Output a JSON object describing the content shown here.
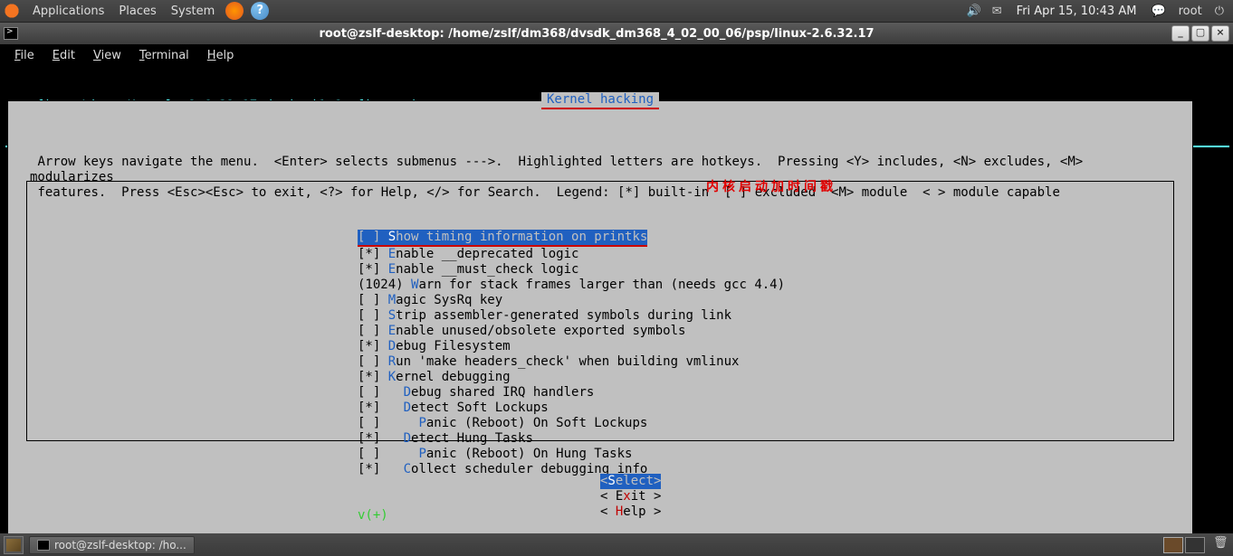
{
  "top_panel": {
    "apps": "Applications",
    "places": "Places",
    "system": "System",
    "clock": "Fri Apr 15, 10:43 AM",
    "user": "root"
  },
  "window": {
    "title": "root@zslf-desktop: /home/zslf/dm368/dvsdk_dm368_4_02_00_06/psp/linux-2.6.32.17"
  },
  "menubar": {
    "file": "File",
    "edit": "Edit",
    "view": "View",
    "terminal": "Terminal",
    "help": "Help"
  },
  "config": {
    "title": ".config - Linux Kernel v2.6.32.17-davinci1 Configuration",
    "section": "Kernel hacking",
    "instructions_l1": " Arrow keys navigate the menu.  <Enter> selects submenus --->.  Highlighted letters are hotkeys.  Pressing <Y> includes, <N> excludes, <M> modularizes",
    "instructions_l2": " features.  Press <Esc><Esc> to exit, <?> for Help, </> for Search.  Legend: [*] built-in  [ ] excluded  <M> module  < > module capable",
    "options": [
      {
        "mark": "[ ]",
        "indent": "",
        "hot": "S",
        "rest": "how timing information on printks",
        "selected": true
      },
      {
        "mark": "[*]",
        "indent": "",
        "hot": "E",
        "rest": "nable __deprecated logic"
      },
      {
        "mark": "[*]",
        "indent": "",
        "hot": "E",
        "rest": "nable __must_check logic"
      },
      {
        "mark": "(1024)",
        "indent": "",
        "hot": "W",
        "rest": "arn for stack frames larger than (needs gcc 4.4)"
      },
      {
        "mark": "[ ]",
        "indent": "",
        "hot": "M",
        "rest": "agic SysRq key"
      },
      {
        "mark": "[ ]",
        "indent": "",
        "hot": "S",
        "rest": "trip assembler-generated symbols during link"
      },
      {
        "mark": "[ ]",
        "indent": "",
        "hot": "E",
        "rest": "nable unused/obsolete exported symbols"
      },
      {
        "mark": "[*]",
        "indent": "",
        "hot": "D",
        "rest": "ebug Filesystem"
      },
      {
        "mark": "[ ]",
        "indent": "",
        "hot": "R",
        "rest": "un 'make headers_check' when building vmlinux"
      },
      {
        "mark": "[*]",
        "indent": "",
        "hot": "K",
        "rest": "ernel debugging"
      },
      {
        "mark": "[ ]",
        "indent": "  ",
        "hot": "D",
        "rest": "ebug shared IRQ handlers"
      },
      {
        "mark": "[*]",
        "indent": "  ",
        "hot": "D",
        "rest": "etect Soft Lockups"
      },
      {
        "mark": "[ ]",
        "indent": "    ",
        "hot": "P",
        "rest": "anic (Reboot) On Soft Lockups"
      },
      {
        "mark": "[*]",
        "indent": "  ",
        "hot": "D",
        "rest": "etect Hung Tasks"
      },
      {
        "mark": "[ ]",
        "indent": "    ",
        "hot": "P",
        "rest": "anic (Reboot) On Hung Tasks"
      },
      {
        "mark": "[*]",
        "indent": "  ",
        "hot": "C",
        "rest": "ollect scheduler debugging info"
      }
    ],
    "scroll_indicator": "v(+)",
    "annotation": "内核启动加时间戳",
    "buttons": {
      "select_l": "<",
      "select_hot": "S",
      "select_rest": "elect>",
      "exit_l": "< E",
      "exit_hot": "x",
      "exit_rest": "it >",
      "help_l": "< ",
      "help_hot": "H",
      "help_rest": "elp >"
    }
  },
  "taskbar": {
    "task1": "root@zslf-desktop: /ho..."
  }
}
